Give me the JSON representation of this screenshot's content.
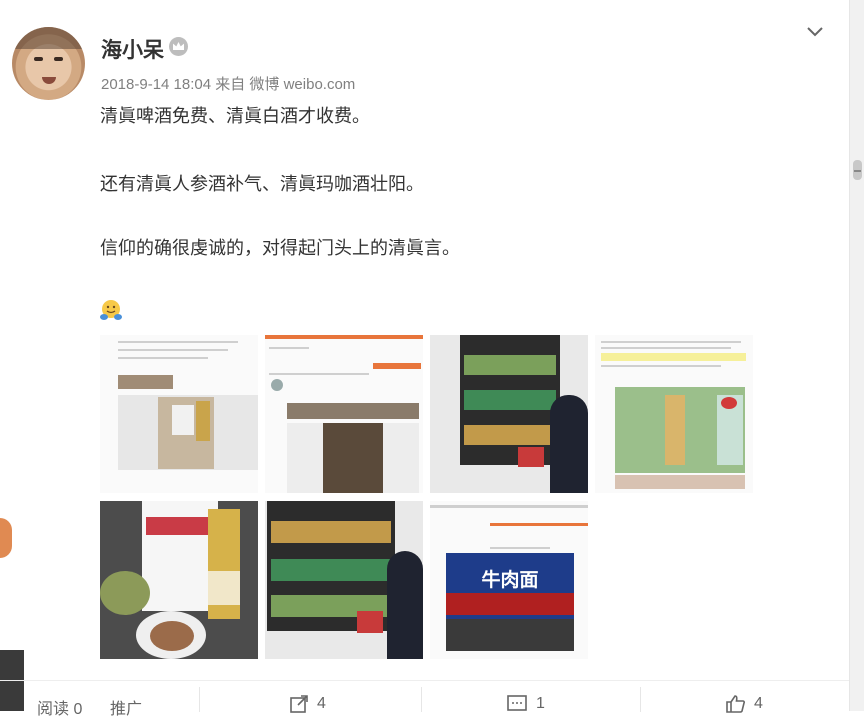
{
  "post": {
    "username": "海小呆",
    "meta": "2018-9-14 18:04 来自 微博 weibo.com",
    "lines": [
      "清眞啤酒免费、清眞白酒才收费。",
      "还有清眞人参酒补气、清眞玛咖酒壮阳。",
      "信仰的确很虔诚的，对得起门头上的清眞言。"
    ]
  },
  "images": [
    {
      "name": "screenshot-article-1"
    },
    {
      "name": "screenshot-article-2"
    },
    {
      "name": "liquor-shelf-photo-1"
    },
    {
      "name": "screenshot-ginseng-wine"
    },
    {
      "name": "hotpot-table-photo"
    },
    {
      "name": "liquor-shelf-photo-2"
    },
    {
      "name": "restaurant-sign-screenshot"
    }
  ],
  "sign_text": "牛肉面",
  "footer": {
    "read": "阅读 0",
    "promote": "推广",
    "repost_count": "4",
    "comment_count": "1",
    "like_count": "4"
  },
  "colors": {
    "accent": "#e8753b",
    "text": "#333333",
    "meta": "#808080"
  }
}
